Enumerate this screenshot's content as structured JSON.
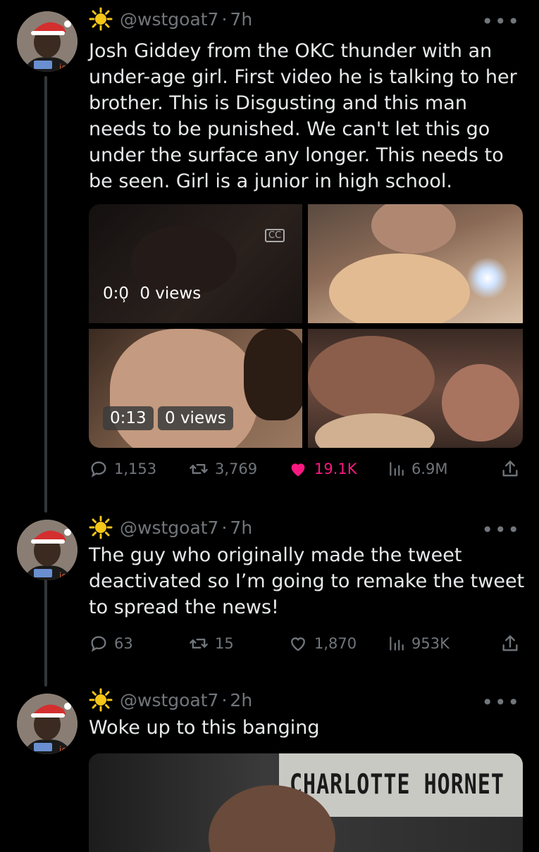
{
  "tweets": [
    {
      "handle": "@wstgoat7",
      "sep": "·",
      "time": "7h",
      "text": "Josh Giddey from the OKC thunder with an under-age girl. First video he is talking to her brother. This is Disgusting and this man needs to be punished. We can't let this go under the surface any longer. This needs to be seen. Girl is a junior in high school.",
      "media": [
        {
          "time": "0:0̹",
          "views": "0 views",
          "cc": "CC"
        },
        {},
        {
          "time": "0:13",
          "views": "0 views"
        },
        {}
      ],
      "stats": {
        "replies": "1,153",
        "retweets": "3,769",
        "likes": "19.1K",
        "views": "6.9M"
      },
      "liked": true
    },
    {
      "handle": "@wstgoat7",
      "sep": "·",
      "time": "7h",
      "text": "The guy who originally made the tweet deactivated so I’m going to remake the tweet to spread the news!",
      "stats": {
        "replies": "63",
        "retweets": "15",
        "likes": "1,870",
        "views": "953K"
      },
      "liked": false
    },
    {
      "handle": "@wstgoat7",
      "sep": "·",
      "time": "2h",
      "text": "Woke up to this banging",
      "banner_text": "CHARLOTTE HORNET"
    }
  ],
  "colors": {
    "accent_like": "#f91880",
    "muted": "#71767b",
    "text": "#e7e9ea",
    "thread": "#333639"
  }
}
